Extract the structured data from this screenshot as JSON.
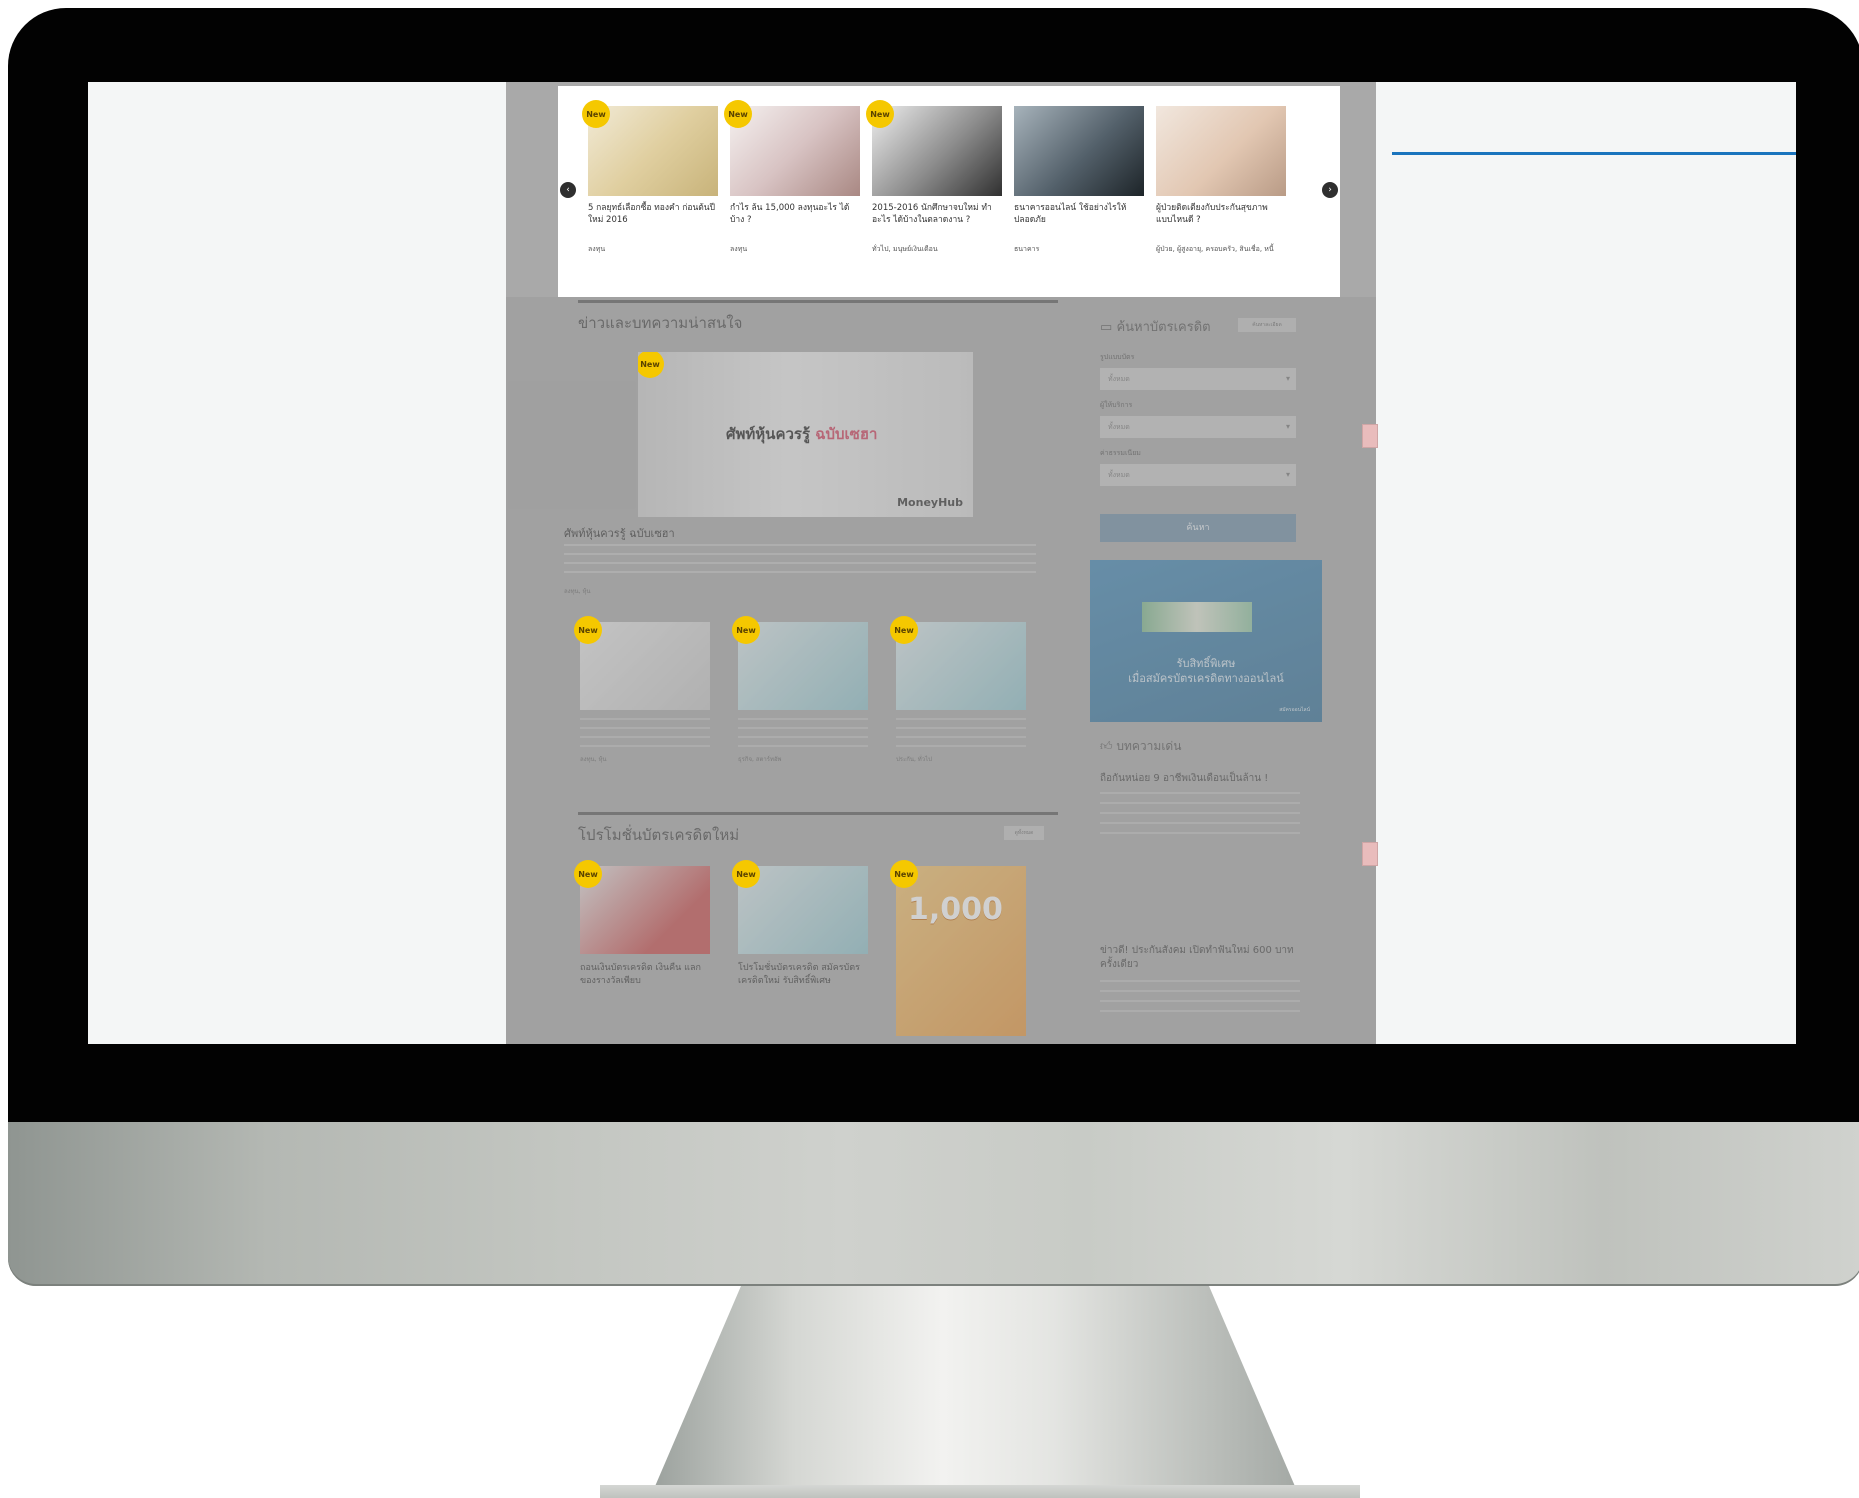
{
  "carousel": {
    "prev_icon": "chevron-left-icon",
    "next_icon": "chevron-right-icon",
    "items": [
      {
        "badge": "New",
        "title": "5 กลยุทธ์เลือกซื้อ ทองคำ ก่อนต้นปีใหม่ 2016",
        "category": "ลงทุน"
      },
      {
        "badge": "New",
        "title": "กำไร ล้น 15,000 ลงทุนอะไร ได้บ้าง ?",
        "category": "ลงทุน"
      },
      {
        "badge": "New",
        "title": "2015-2016 นักศึกษาจบใหม่ ทำอะไร ได้บ้างในตลาดงาน ?",
        "category": "ทั่วไป, มนุษย์เงินเดือน"
      },
      {
        "badge": "",
        "title": "ธนาคารออนไลน์ ใช้อย่างไรให้ปลอดภัย",
        "category": "ธนาคาร"
      },
      {
        "badge": "",
        "title": "ผู้ป่วยติดเตียงกับประกันสุขภาพ แบบไหนดี ?",
        "category": "ผู้ป่วย, ผู้สูงอายุ, ครอบครัว, สินเชื่อ, หนี้"
      }
    ]
  },
  "news": {
    "heading": "ข่าวและบทความน่าสนใจ",
    "hero": {
      "badge": "New",
      "image_text": "ศัพท์หุ้นควรรู้",
      "image_accent": "ฉบับเซฮา",
      "brand": "MoneyHub",
      "title": "ศัพท์หุ้นควรรู้ ฉบับเซฮา",
      "tags": "ลงทุน, หุ้น"
    },
    "cards": [
      {
        "badge": "New",
        "tags": "ลงทุน, หุ้น"
      },
      {
        "badge": "New",
        "tags": "ธุรกิจ, สตาร์ทอัพ"
      },
      {
        "badge": "New",
        "tags": "ประกัน, ทั่วไป"
      }
    ]
  },
  "promo": {
    "heading": "โปรโมชั่นบัตรเครดิตใหม่",
    "more_label": "ดูทั้งหมด",
    "items": [
      {
        "badge": "New",
        "title": "ถอนเงินบัตรเครดิต เงินคืน แลก ของรางวัลเพียบ"
      },
      {
        "badge": "New",
        "title": "โปรโมชั่นบัตรเครดิต สมัครบัตรเครดิตใหม่ รับสิทธิ์พิเศษ"
      },
      {
        "badge": "New",
        "big_number": "1,000",
        "title": ""
      }
    ]
  },
  "sidebar": {
    "search_title": "ค้นหาบัตรเครดิต",
    "search_icon": "credit-card-icon",
    "small_button": "ค้นหาละเอียด",
    "fields": [
      {
        "label": "รูปแบบบัตร",
        "value": "ทั้งหมด"
      },
      {
        "label": "ผู้ให้บริการ",
        "value": "ทั้งหมด"
      },
      {
        "label": "ค่าธรรมเนียม",
        "value": "ทั้งหมด"
      }
    ],
    "search_button": "ค้นหา",
    "banner": {
      "line1": "รับสิทธิ์พิเศษ",
      "line2": "เมื่อสมัครบัตรเครดิตทางออนไลน์",
      "foot": "สมัครออนไลน์"
    },
    "popular": {
      "heading": "บทความเด่น",
      "icon": "thumbs-up-icon",
      "articles": [
        {
          "title": "ถือกันหน่อย 9 อาชีพเงินเดือนเป็นล้าน !"
        },
        {
          "title": "ข่าวดี! ประกันสังคม เปิดทำฟันใหม่ 600 บาทครั้งเดียว"
        }
      ]
    }
  }
}
